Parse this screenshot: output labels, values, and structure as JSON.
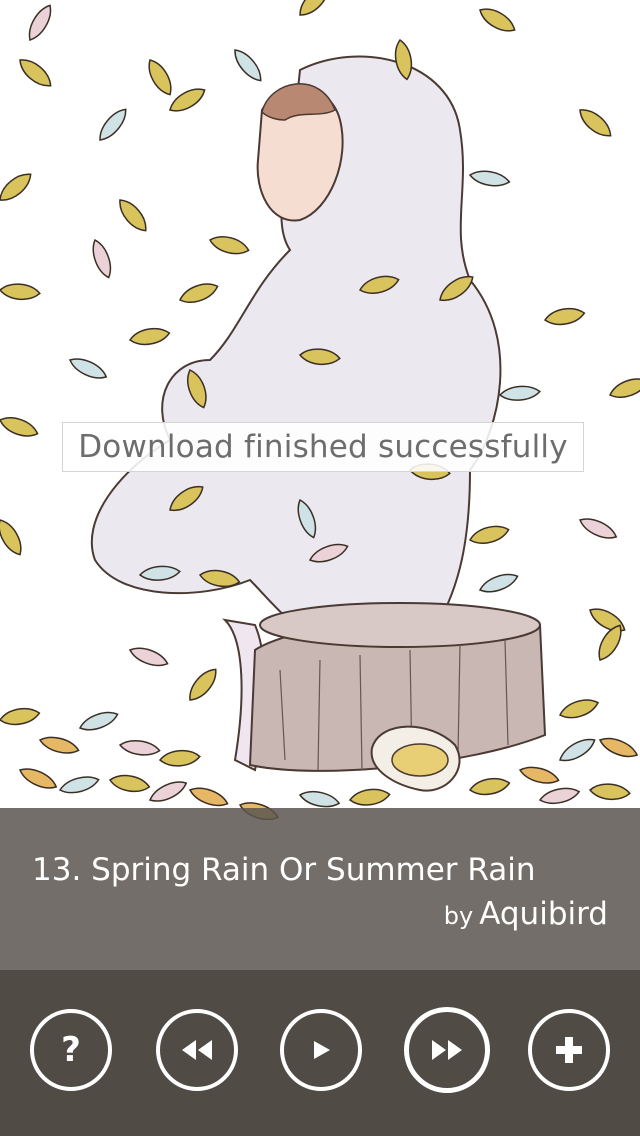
{
  "artwork": {
    "description_icon": "album-art-illustration"
  },
  "toast": {
    "message": "Download finished successfully"
  },
  "track": {
    "title": "13. Spring Rain Or Summer Rain",
    "by_label": "by",
    "artist": "Aquibird"
  },
  "controls": {
    "help_icon": "question-icon",
    "help_glyph": "?",
    "prev_icon": "rewind-icon",
    "play_icon": "play-icon",
    "next_icon": "fast-forward-icon",
    "add_icon": "plus-icon"
  },
  "colors": {
    "panel_bg": "#5c5650",
    "controls_bg": "#514b46",
    "text": "#ffffff",
    "toast_text": "#6d6d6d"
  }
}
